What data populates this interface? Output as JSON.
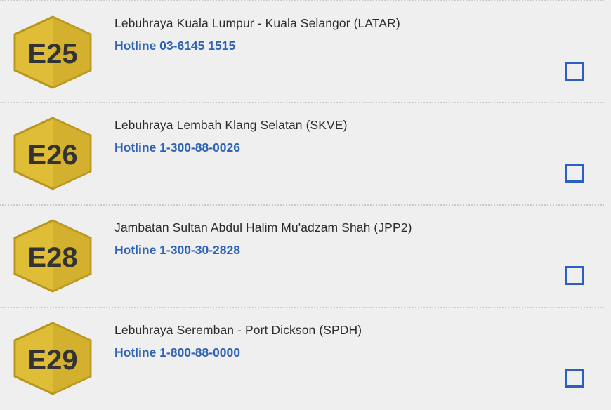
{
  "colors": {
    "background": "#efefef",
    "hotline": "#2f63b7",
    "checkbox": "#2b5fc1",
    "badge_fill": "#e0bd36",
    "badge_shade": "#c9a72a",
    "badge_border": "#b8961e",
    "badge_text": "#333333"
  },
  "highways": [
    {
      "code": "E25",
      "name": "Lebuhraya Kuala Lumpur - Kuala Selangor (LATAR)",
      "hotline": "Hotline 03-6145 1515",
      "checked": false
    },
    {
      "code": "E26",
      "name": "Lebuhraya Lembah Klang Selatan (SKVE)",
      "hotline": "Hotline 1-300-88-0026",
      "checked": false
    },
    {
      "code": "E28",
      "name": "Jambatan Sultan Abdul Halim Mu'adzam Shah (JPP2)",
      "hotline": "Hotline 1-300-30-2828",
      "checked": false
    },
    {
      "code": "E29",
      "name": "Lebuhraya Seremban - Port Dickson (SPDH)",
      "hotline": "Hotline 1-800-88-0000",
      "checked": false
    }
  ]
}
